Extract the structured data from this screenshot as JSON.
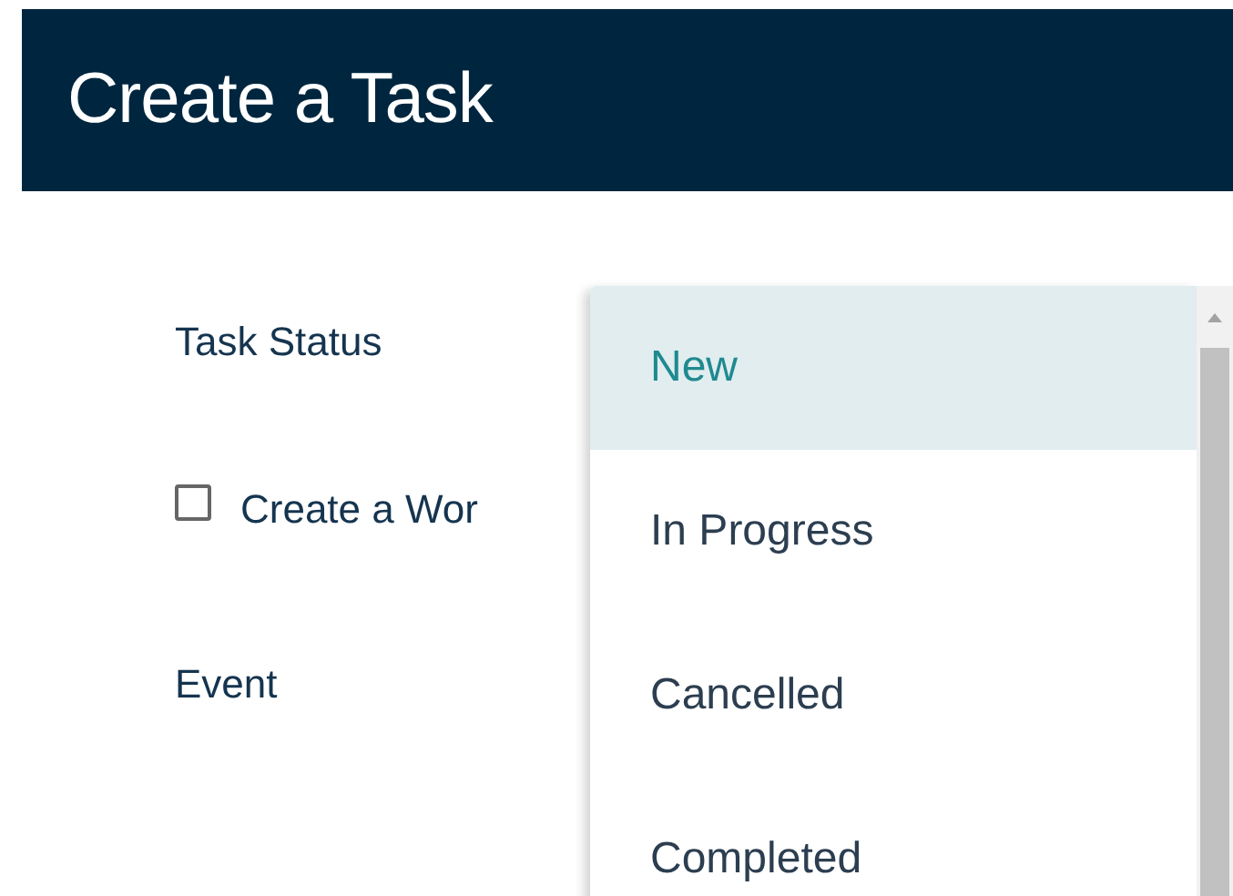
{
  "header": {
    "title": "Create a Task"
  },
  "form": {
    "fields": [
      {
        "kind": "label",
        "label": "Task Status"
      },
      {
        "kind": "checkbox",
        "label": "Create a Wor",
        "checked": false
      },
      {
        "kind": "label",
        "label": "Event"
      }
    ]
  },
  "dropdown": {
    "options": [
      {
        "label": "New",
        "selected": true
      },
      {
        "label": "In Progress",
        "selected": false
      },
      {
        "label": "Cancelled",
        "selected": false
      },
      {
        "label": "Completed",
        "selected": false
      }
    ]
  }
}
